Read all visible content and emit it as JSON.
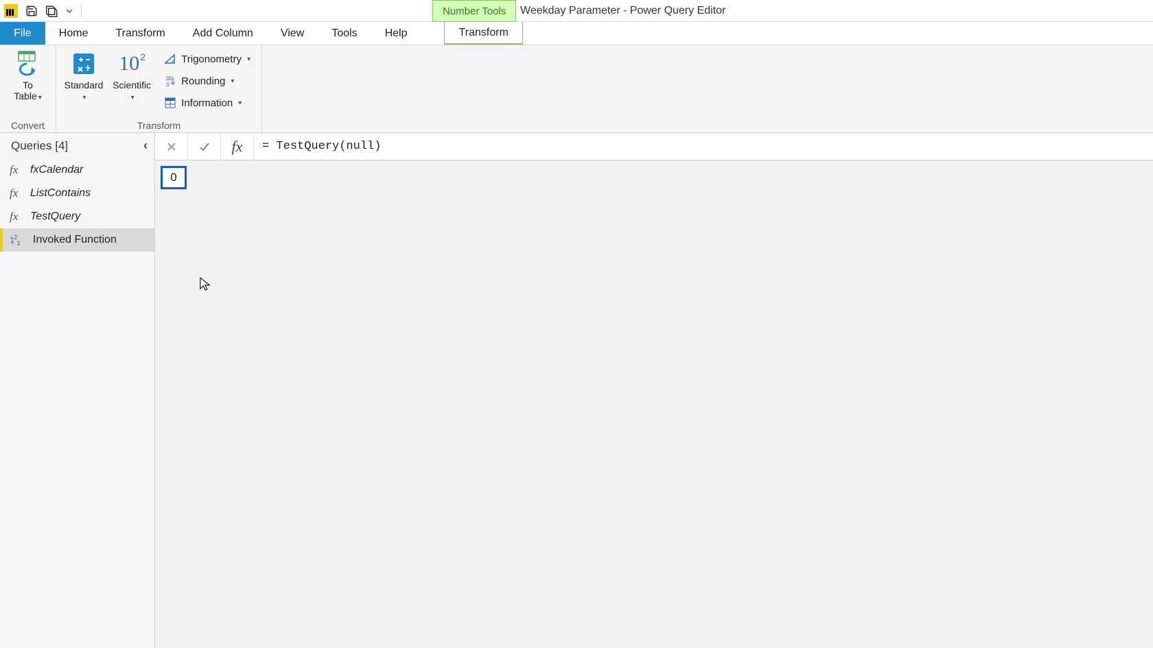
{
  "titlebar": {
    "context_tool_label": "Number Tools",
    "window_title": "Weekday Parameter - Power Query Editor"
  },
  "tabs": {
    "file": "File",
    "home": "Home",
    "transform": "Transform",
    "add_column": "Add Column",
    "view": "View",
    "tools": "Tools",
    "help": "Help",
    "context_transform": "Transform"
  },
  "ribbon": {
    "convert_group": "Convert",
    "to_table": "To\nTable",
    "transform_group": "Transform",
    "standard": "Standard",
    "scientific": "Scientific",
    "trigonometry": "Trigonometry",
    "rounding": "Rounding",
    "information": "Information"
  },
  "queries": {
    "header": "Queries [4]",
    "items": [
      {
        "icon": "fx",
        "label": "fxCalendar"
      },
      {
        "icon": "fx",
        "label": "ListContains"
      },
      {
        "icon": "fx",
        "label": "TestQuery"
      },
      {
        "icon": "num",
        "label": "Invoked Function"
      }
    ],
    "selected_index": 3
  },
  "formula": "= TestQuery(null)",
  "result_value": "0"
}
